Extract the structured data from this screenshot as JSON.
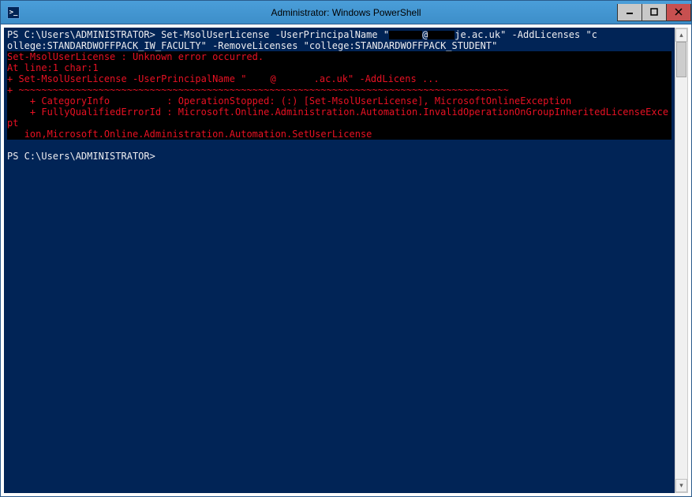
{
  "window": {
    "title": "Administrator: Windows PowerShell"
  },
  "console": {
    "line1": "PS C:\\Users\\ADMINISTRATOR> Set-MsolUserLicense -UserPrincipalName \"",
    "line1b": "je.ac.uk\" -AddLicenses \"c",
    "line2": "ollege:STANDARDWOFFPACK_IW_FACULTY\" -RemoveLicenses \"college:STANDARDWOFFPACK_STUDENT\"",
    "err1": "Set-MsolUserLicense : Unknown error occurred.",
    "err2": "At line:1 char:1",
    "err3a": "+ Set-MsolUserLicense -UserPrincipalName \"",
    "err3b": ".ac.uk\" -AddLicens ...",
    "err4": "+ ~~~~~~~~~~~~~~~~~~~~~~~~~~~~~~~~~~~~~~~~~~~~~~~~~~~~~~~~~~~~~~~~~~~~~~~~~~~~~~~~~~~~~~",
    "err5": "    + CategoryInfo          : OperationStopped: (:) [Set-MsolUserLicense], MicrosoftOnlineException",
    "err6": "    + FullyQualifiedErrorId : Microsoft.Online.Administration.Automation.InvalidOperationOnGroupInheritedLicenseExcept",
    "err7": "   ion,Microsoft.Online.Administration.Automation.SetUserLicense",
    "prompt2": "PS C:\\Users\\ADMINISTRATOR> "
  }
}
